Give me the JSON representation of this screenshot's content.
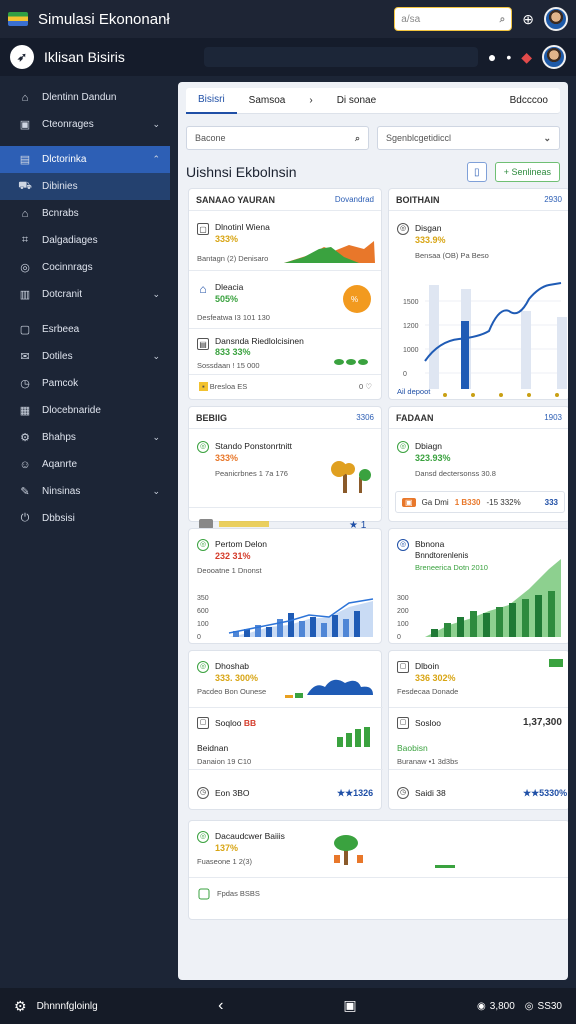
{
  "topbar": {
    "title": "Simulasi Ekononanł",
    "search_placeholder": "a/sa"
  },
  "header": {
    "brand": "Iklisan Bisiris"
  },
  "sidebar": {
    "items": [
      {
        "icon": "home-icon",
        "glyph": "⌂",
        "label": "Dlentinn Dandun"
      },
      {
        "icon": "box-icon",
        "glyph": "▣",
        "label": "Cteonrages"
      },
      {
        "icon": "chart-icon",
        "glyph": "▤",
        "label": "Dlctorinka"
      },
      {
        "icon": "cart-icon",
        "glyph": "⛟",
        "label": "Dibinies"
      },
      {
        "icon": "store-icon",
        "glyph": "⌂",
        "label": "Bcnrabs"
      },
      {
        "icon": "tag-icon",
        "glyph": "⌗",
        "label": "Dalgadiages"
      },
      {
        "icon": "coin-icon",
        "glyph": "◎",
        "label": "Cocinnrags"
      },
      {
        "icon": "doc-icon",
        "glyph": "▥",
        "label": "Dotcranit"
      },
      {
        "icon": "folder-icon",
        "glyph": "▢",
        "label": "Esrbeea"
      },
      {
        "icon": "mail-icon",
        "glyph": "✉",
        "label": "Dotiles"
      },
      {
        "icon": "clock-icon",
        "glyph": "◷",
        "label": "Pamcok"
      },
      {
        "icon": "grid-icon",
        "glyph": "▦",
        "label": "Dlocebnaride"
      },
      {
        "icon": "cog-icon",
        "glyph": "⚙",
        "label": "Bhahps"
      },
      {
        "icon": "user-icon",
        "glyph": "☺",
        "label": "Aqanrte"
      },
      {
        "icon": "pen-icon",
        "glyph": "✎",
        "label": "Ninsinas"
      },
      {
        "icon": "power-icon",
        "glyph": "⏻",
        "label": "Dbbsisi"
      }
    ]
  },
  "tabs": [
    "Bisisri",
    "Samsoa",
    "Di sonae",
    "Bdcccoo"
  ],
  "filters": {
    "search": "Bacone",
    "select": "Sgenblcgetidiccl"
  },
  "page_title": "Uishnsi Ekbolnsin",
  "green_btn": "Senlineas",
  "cards": {
    "c1": {
      "title": "SANAAO YAURAN",
      "link": "Dovandrad"
    },
    "c2": {
      "title": "BOITHAIN",
      "link": "2930"
    },
    "c3": {
      "title": "BEBIIG",
      "link": "3306"
    },
    "c4": {
      "title": "FADAAN",
      "link": "1903"
    }
  },
  "rows": {
    "r1": {
      "name": "Dlnotinl Wiena",
      "pct": "333%",
      "sub": "Bantagn (2) Denisaro"
    },
    "r2": {
      "name": "Dleacia",
      "pct": "505%",
      "sub": "Desfeatwa I3 101 130"
    },
    "r3": {
      "name": "Dansnda Riedlolcisinen",
      "pct": "833 33%",
      "sub": "Sossdaan ! 15 000"
    },
    "r3f": {
      "text": "Bresloa ES"
    },
    "r4": {
      "name": "Disgan",
      "pct": "333.9%",
      "sub": "Bensaa  (OB) Pa Beso"
    },
    "r4f": {
      "text": "Ail depoot"
    },
    "r5": {
      "name": "Stando Ponstonrtnitt",
      "pct": "333%",
      "sub": "Peanicrbnes 1 7a 176"
    },
    "r6": {
      "name": "Dbiagn",
      "pct": "323.93%",
      "sub": "Dansd dectersonss 30.8"
    },
    "r6f": {
      "name": "Ga Dmi",
      "val": "1 B330",
      "pct": "-15 332%",
      "end": "333"
    },
    "r7": {
      "name": "Pertom Delon",
      "pct": "232 31%",
      "sub": "Deooatne   1 Dnonst"
    },
    "r8": {
      "name": "Bbnona",
      "pct": "Bnndtorenlenis",
      "sub": "Breneerica Dotn 2010"
    },
    "r9": {
      "name": "Dhoshab",
      "pct": "333. 300%",
      "sub": "Pacdeo   Bon Ounese"
    },
    "r9b": {
      "name": "Soqloo",
      "val": "BB"
    },
    "r9c": {
      "name": "Beidnan",
      "sub": "Danaion  19 C10"
    },
    "r9f": {
      "name": "Eon 3BO",
      "val": "★★1326"
    },
    "r10": {
      "name": "Dlboin",
      "pct": "336 302%",
      "sub": "Fesdecaa  Donade"
    },
    "r10b": {
      "name": "Sosloo",
      "val": "1,37,300"
    },
    "r10c": {
      "name": "Baobisn",
      "sub": "Buranaw  •1 3d3bs"
    },
    "r10f": {
      "name": "Saidi 38",
      "val": "★★5330%"
    },
    "r11": {
      "name": "Dacaudcwer Baiiis",
      "pct": "137%",
      "sub": "Fuaseone 1 2(3)"
    },
    "r11f": {
      "text": "Fpdas  BSBS"
    }
  },
  "chart_ticks": {
    "c2": [
      "1500",
      "1200",
      "1000",
      "0"
    ],
    "c5": [
      "350",
      "600",
      "100",
      "0"
    ],
    "c6": [
      "300",
      "200",
      "100",
      "0"
    ]
  },
  "bottom": {
    "label": "Dhnnnfgloinlg",
    "r1": "3,800",
    "r2": "SS30"
  },
  "colors": {
    "accent": "#2d5fb5",
    "green": "#3aa23f",
    "orange": "#e8772a",
    "yellow": "#d8a514"
  }
}
